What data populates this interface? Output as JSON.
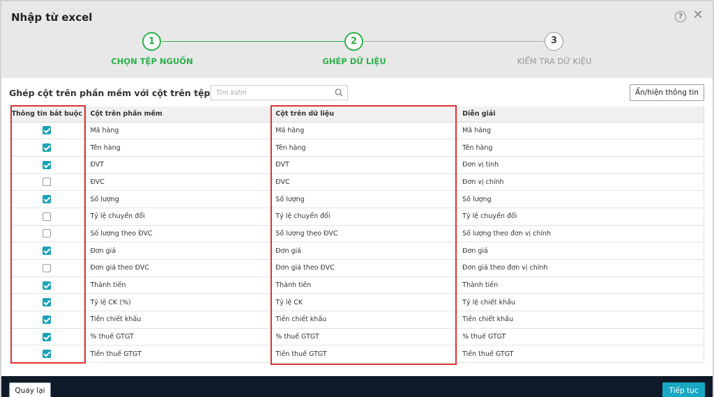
{
  "dialog": {
    "title": "Nhập từ excel"
  },
  "steps": [
    {
      "number": "1",
      "label": "CHỌN TỆP NGUỒN",
      "state": "done"
    },
    {
      "number": "2",
      "label": "GHÉP DỮ LIỆU",
      "state": "active"
    },
    {
      "number": "3",
      "label": "KIỂM TRA DỮ KIỆU",
      "state": "pending"
    }
  ],
  "toolbar": {
    "subtitle": "Ghép cột trên phần mềm với cột trên tệp dữ liệu",
    "search_placeholder": "Tìm kiếm",
    "toggle_label": "Ẩn/hiện thông tin"
  },
  "table": {
    "headers": [
      "Thông tin bắt buộc",
      "Cột trên phần mềm",
      "Cột trên dữ liệu",
      "Diễn giải"
    ],
    "rows": [
      {
        "checked": true,
        "software": "Mã hàng",
        "data": "Mã hàng",
        "desc": "Mã hàng"
      },
      {
        "checked": true,
        "software": "Tên hàng",
        "data": "Tên hàng",
        "desc": "Tên hàng"
      },
      {
        "checked": true,
        "software": "ĐVT",
        "data": "ĐVT",
        "desc": "Đơn vị tính"
      },
      {
        "checked": false,
        "software": "ĐVC",
        "data": "ĐVC",
        "desc": "Đơn vị chính"
      },
      {
        "checked": true,
        "software": "Số lượng",
        "data": "Số lượng",
        "desc": "Số lượng"
      },
      {
        "checked": false,
        "software": "Tỷ lệ chuyển đổi",
        "data": "Tỷ lệ chuyển đổi",
        "desc": "Tỷ lệ chuyển đổi"
      },
      {
        "checked": false,
        "software": "Số lượng theo ĐVC",
        "data": "Số lượng theo ĐVC",
        "desc": "Số lượng theo đơn vị chính"
      },
      {
        "checked": true,
        "software": "Đơn giá",
        "data": "Đơn giá",
        "desc": "Đơn giá"
      },
      {
        "checked": false,
        "software": "Đơn giá theo ĐVC",
        "data": "Đơn giá theo ĐVC",
        "desc": "Đơn giá theo đơn vị chính"
      },
      {
        "checked": true,
        "software": "Thành tiền",
        "data": "Thành tiền",
        "desc": "Thành tiền"
      },
      {
        "checked": true,
        "software": "Tỷ lệ CK (%)",
        "data": "Tỷ lệ CK",
        "desc": "Tỷ lệ chiết khấu"
      },
      {
        "checked": true,
        "software": "Tiền chiết khấu",
        "data": "Tiền chiết khấu",
        "desc": "Tiền chiết khấu"
      },
      {
        "checked": true,
        "software": "% thuế GTGT",
        "data": "% thuế GTGT",
        "desc": "% thuế GTGT"
      },
      {
        "checked": true,
        "software": "Tiền thuế GTGT",
        "data": "Tiền thuế GTGT",
        "desc": "Tiền thuế GTGT"
      }
    ]
  },
  "footer": {
    "back_label": "Quay lại",
    "next_label": "Tiếp tục"
  },
  "colors": {
    "step_active": "#2cb04a",
    "checkbox": "#1aa3b8",
    "highlight": "#e03131",
    "footer_bg": "#0e1a28",
    "primary_button": "#19a8c2"
  }
}
